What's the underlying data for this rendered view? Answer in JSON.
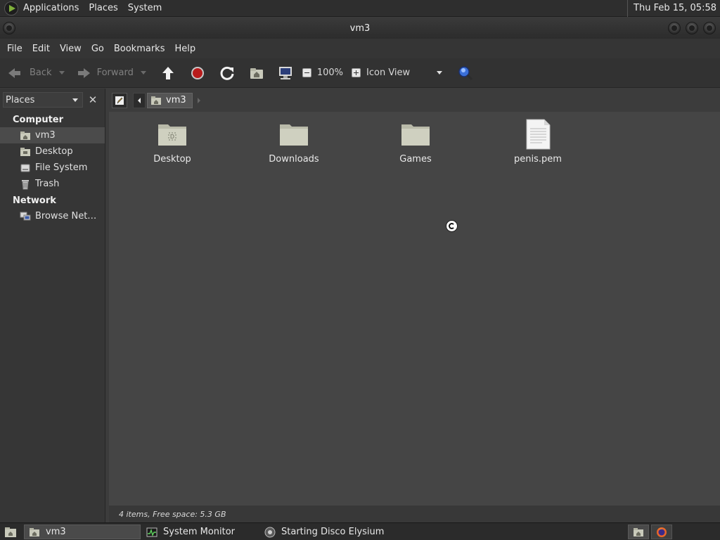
{
  "top_panel": {
    "menus": [
      "Applications",
      "Places",
      "System"
    ],
    "clock": "Thu Feb 15, 05:58"
  },
  "window": {
    "title": "vm3",
    "menubar": [
      "File",
      "Edit",
      "View",
      "Go",
      "Bookmarks",
      "Help"
    ]
  },
  "toolbar": {
    "back_label": "Back",
    "forward_label": "Forward",
    "zoom_level": "100%",
    "view_mode": "Icon View"
  },
  "sidebar": {
    "combo_label": "Places",
    "sections": [
      {
        "title": "Computer",
        "items": [
          {
            "label": "vm3",
            "icon": "home-folder-icon",
            "selected": true
          },
          {
            "label": "Desktop",
            "icon": "desktop-folder-icon",
            "selected": false
          },
          {
            "label": "File System",
            "icon": "drive-icon",
            "selected": false
          },
          {
            "label": "Trash",
            "icon": "trash-icon",
            "selected": false
          }
        ]
      },
      {
        "title": "Network",
        "items": [
          {
            "label": "Browse Net…",
            "icon": "network-icon",
            "selected": false
          }
        ]
      }
    ]
  },
  "location": {
    "crumb": "vm3"
  },
  "files": [
    {
      "name": "Desktop",
      "icon": "desktop-folder-icon"
    },
    {
      "name": "Downloads",
      "icon": "folder-icon"
    },
    {
      "name": "Games",
      "icon": "folder-icon"
    },
    {
      "name": "penis.pem",
      "icon": "text-file-icon"
    }
  ],
  "status": "4 items, Free space: 5.3 GB",
  "taskbar": {
    "tasks": [
      {
        "label": "vm3",
        "active": true
      },
      {
        "label": "System Monitor",
        "active": false
      },
      {
        "label": "Starting Disco Elysium",
        "active": false
      }
    ]
  },
  "colors": {
    "panel_bg": "#2e2e2e",
    "content_bg": "#454545",
    "sidebar_bg": "#363636",
    "selection_bg": "#4b4b4b",
    "folder_color": "#cfd0c0"
  }
}
